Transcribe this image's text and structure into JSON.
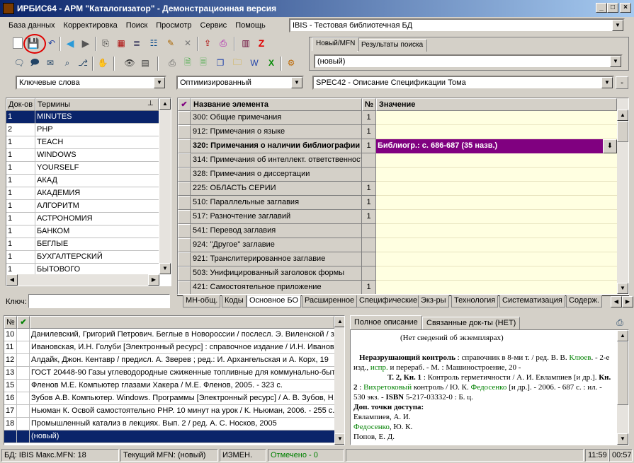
{
  "window": {
    "title": "ИРБИС64 - АРМ \"Каталогизатор\" - Демонстрационная версия"
  },
  "menu": [
    "База данных",
    "Корректировка",
    "Поиск",
    "Просмотр",
    "Сервис",
    "Помощь"
  ],
  "db_combo": "IBIS - Тестовая библиотечная БД",
  "right_tabs": [
    "Новый/MFN",
    "Результаты поиска"
  ],
  "mfn_combo": "(новый)",
  "search_combo": "Ключевые слова",
  "mode_combo": "Оптимизированный",
  "worksheet_combo": "SPEC42 - Описание Спецификации Тома",
  "terms": {
    "headers": [
      "Док-ов",
      "Термины"
    ],
    "rows": [
      {
        "count": "1",
        "term": "MINUTES"
      },
      {
        "count": "2",
        "term": "PHP"
      },
      {
        "count": "1",
        "term": "TEACH"
      },
      {
        "count": "1",
        "term": "WINDOWS"
      },
      {
        "count": "1",
        "term": "YOURSELF"
      },
      {
        "count": "1",
        "term": "АКАД"
      },
      {
        "count": "1",
        "term": "АКАДЕМИЯ"
      },
      {
        "count": "1",
        "term": "АЛГОРИТМ"
      },
      {
        "count": "1",
        "term": "АСТРОНОМИЯ"
      },
      {
        "count": "1",
        "term": "БАНКОМ"
      },
      {
        "count": "1",
        "term": "БЕГЛЫЕ"
      },
      {
        "count": "1",
        "term": "БУХГАЛТЕРСКИЙ"
      },
      {
        "count": "1",
        "term": "БЫТОВОГО"
      }
    ],
    "key_label": "Ключ:"
  },
  "fields": {
    "headers": [
      "Название элемента",
      "№",
      "Значение"
    ],
    "rows": [
      {
        "name": "300: Общие примечания",
        "num": "1",
        "value": ""
      },
      {
        "name": "912: Примечания о языке",
        "num": "1",
        "value": ""
      },
      {
        "name": "320: Примечания о наличии библиографии",
        "num": "1",
        "value": "Библиогр.: с. 686-687 (35 назв.)"
      },
      {
        "name": "314: Примечания об интеллект. ответственности",
        "num": "",
        "value": ""
      },
      {
        "name": "328: Примечания о диссертации",
        "num": "",
        "value": ""
      },
      {
        "name": "225: ОБЛАСТЬ СЕРИИ",
        "num": "1",
        "value": ""
      },
      {
        "name": "510: Параллельные заглавия",
        "num": "1",
        "value": ""
      },
      {
        "name": "517: Разночтение заглавий",
        "num": "1",
        "value": ""
      },
      {
        "name": "541: Перевод заглавия",
        "num": "",
        "value": ""
      },
      {
        "name": "924: \"Другое\" заглавие",
        "num": "",
        "value": ""
      },
      {
        "name": "921: Транслитерированное заглавие",
        "num": "",
        "value": ""
      },
      {
        "name": "503: Унифицированный заголовок формы",
        "num": "",
        "value": ""
      },
      {
        "name": "421: Самостоятельное приложение",
        "num": "1",
        "value": ""
      }
    ]
  },
  "bottom_tabs": [
    "МН-общ.",
    "Коды",
    "Основное БО",
    "Расширенное",
    "Специфические",
    "Экз-ры",
    "Технология",
    "Систематизация",
    "Содерж."
  ],
  "records": {
    "header": "№",
    "rows": [
      {
        "n": "10",
        "text": "Данилевский, Григорий Петрович. Беглые в Новороссии / послесл. Э. Виленской / за"
      },
      {
        "n": "11",
        "text": "Ивановская, И.Н. Голуби [Электронный ресурс] : справочное издание / И.Н. Ивановс"
      },
      {
        "n": "12",
        "text": "Алдайк, Джон. Кентавр / предисл. А. Зверев ; ред.: И. Архангельская и А. Корх, 19"
      },
      {
        "n": "13",
        "text": "ГОСТ 20448-90 Газы углеводородные сжиженные топливные для коммунально-быто"
      },
      {
        "n": "15",
        "text": "Фленов М.Е. Компьютер глазами Хакера / М.Е. Фленов, 2005. - 323 с."
      },
      {
        "n": "16",
        "text": "Зубов А.В. Компьютер. Windows. Программы [Электронный ресурс] / А. В. Зубов, Н."
      },
      {
        "n": "17",
        "text": "Ньюман К. Освой самостоятельно PHP. 10 минут на урок / К. Ньюман, 2006. - 255 с."
      },
      {
        "n": "18",
        "text": "Промышленный катализ в лекциях. Вып. 2 / ред. А. С. Носков, 2005"
      },
      {
        "n": "",
        "text": "(новый)"
      }
    ]
  },
  "desc_tabs": [
    "Полное описание",
    "Связанные док-ты (НЕТ)"
  ],
  "description": {
    "no_copies": "(Нет сведений об экземплярах)",
    "p1_bold": "Неразрушающий контроль",
    "p1_rest": " : справочник в 8-ми т. / ред. В. В. ",
    "p1_link1": "Клюев",
    "p1_rest2": ". - 2-е изд., ",
    "p1_link2": "испр.",
    "p1_rest3": " и перераб. - М. : Машиностроение, 20 -",
    "p2_bold": "Т. 2, Кн. 1",
    "p2_rest": " : Контроль герметичности / А. И. Евлампиев [и др.]. ",
    "p2_bold2": "Кн. 2",
    "p2_rest2": " : ",
    "p2_link1": "Вихретоковый",
    "p2_rest3": " контроль / Ю. К. ",
    "p2_link2": "Федосенко",
    "p2_rest4": " [и др.]. - 2006. - 687 с. : ил. - 530 экз. - ",
    "p2_isbn": "ISBN",
    "p2_rest5": " 5-217-03332-0 : Б. ц.",
    "access_label": "Доп. точки доступа:",
    "access1": "Евлампиев, А. И.",
    "access2_link": "Федосенко",
    "access2_rest": ", Ю. К.",
    "access3": "Попов, Е. Д."
  },
  "status": {
    "db": "БД: IBIS Макс.MFN: 18",
    "current": "Текущий MFN: (новый)",
    "changed": "ИЗМЕН.",
    "marked": "Отмечено - 0",
    "time": "11:59",
    "time2": "00:57"
  },
  "colors": {
    "selection": "#0a246a",
    "value_bg": "#ffffe1",
    "edit_bg": "#800080",
    "green": "#008000",
    "highlight_circle": "#e00000"
  }
}
